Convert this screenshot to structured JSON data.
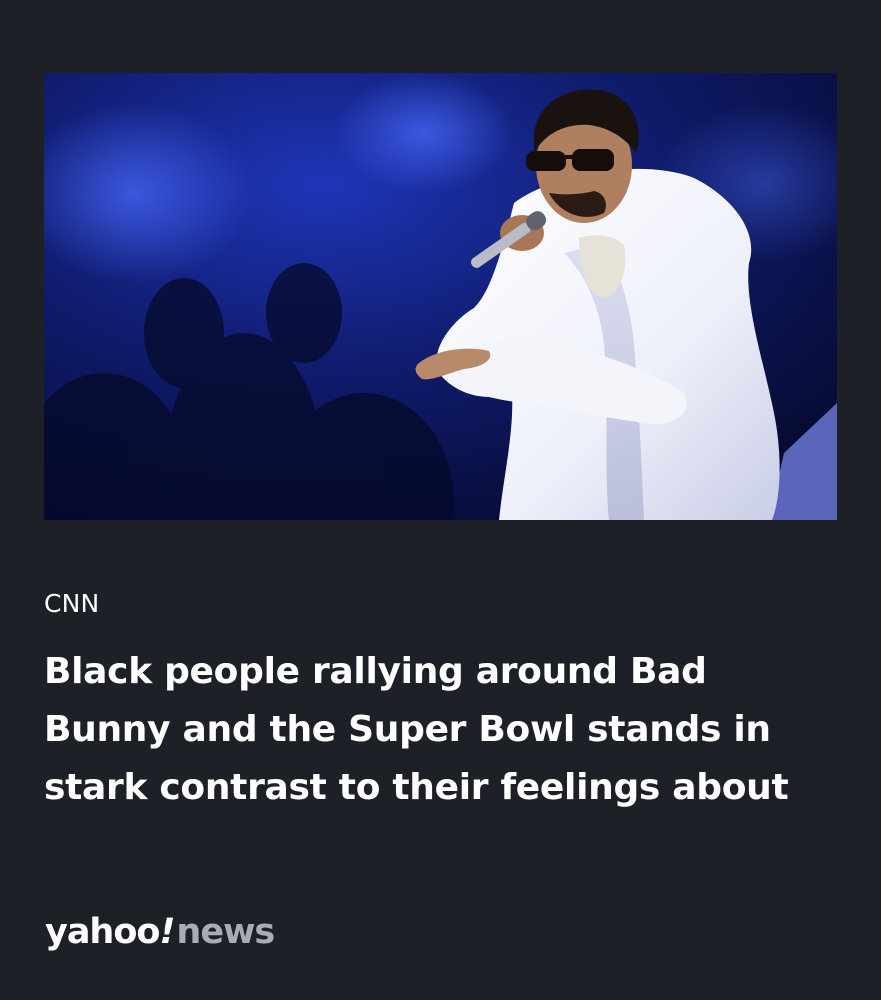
{
  "article": {
    "source": "CNN",
    "headline": "Black people rallying around Bad Bunny and the Super Bowl stands in stark contrast to their feelings about"
  },
  "image": {
    "subject": "performer-in-white-fur-coat-singing"
  },
  "brand": {
    "name": "yahoo",
    "bang": "!",
    "product": "news"
  },
  "colors": {
    "background": "#1d2027",
    "text": "#ffffff",
    "logo_news": "#a9acb6",
    "stage_blue": "#1a2a9c"
  }
}
